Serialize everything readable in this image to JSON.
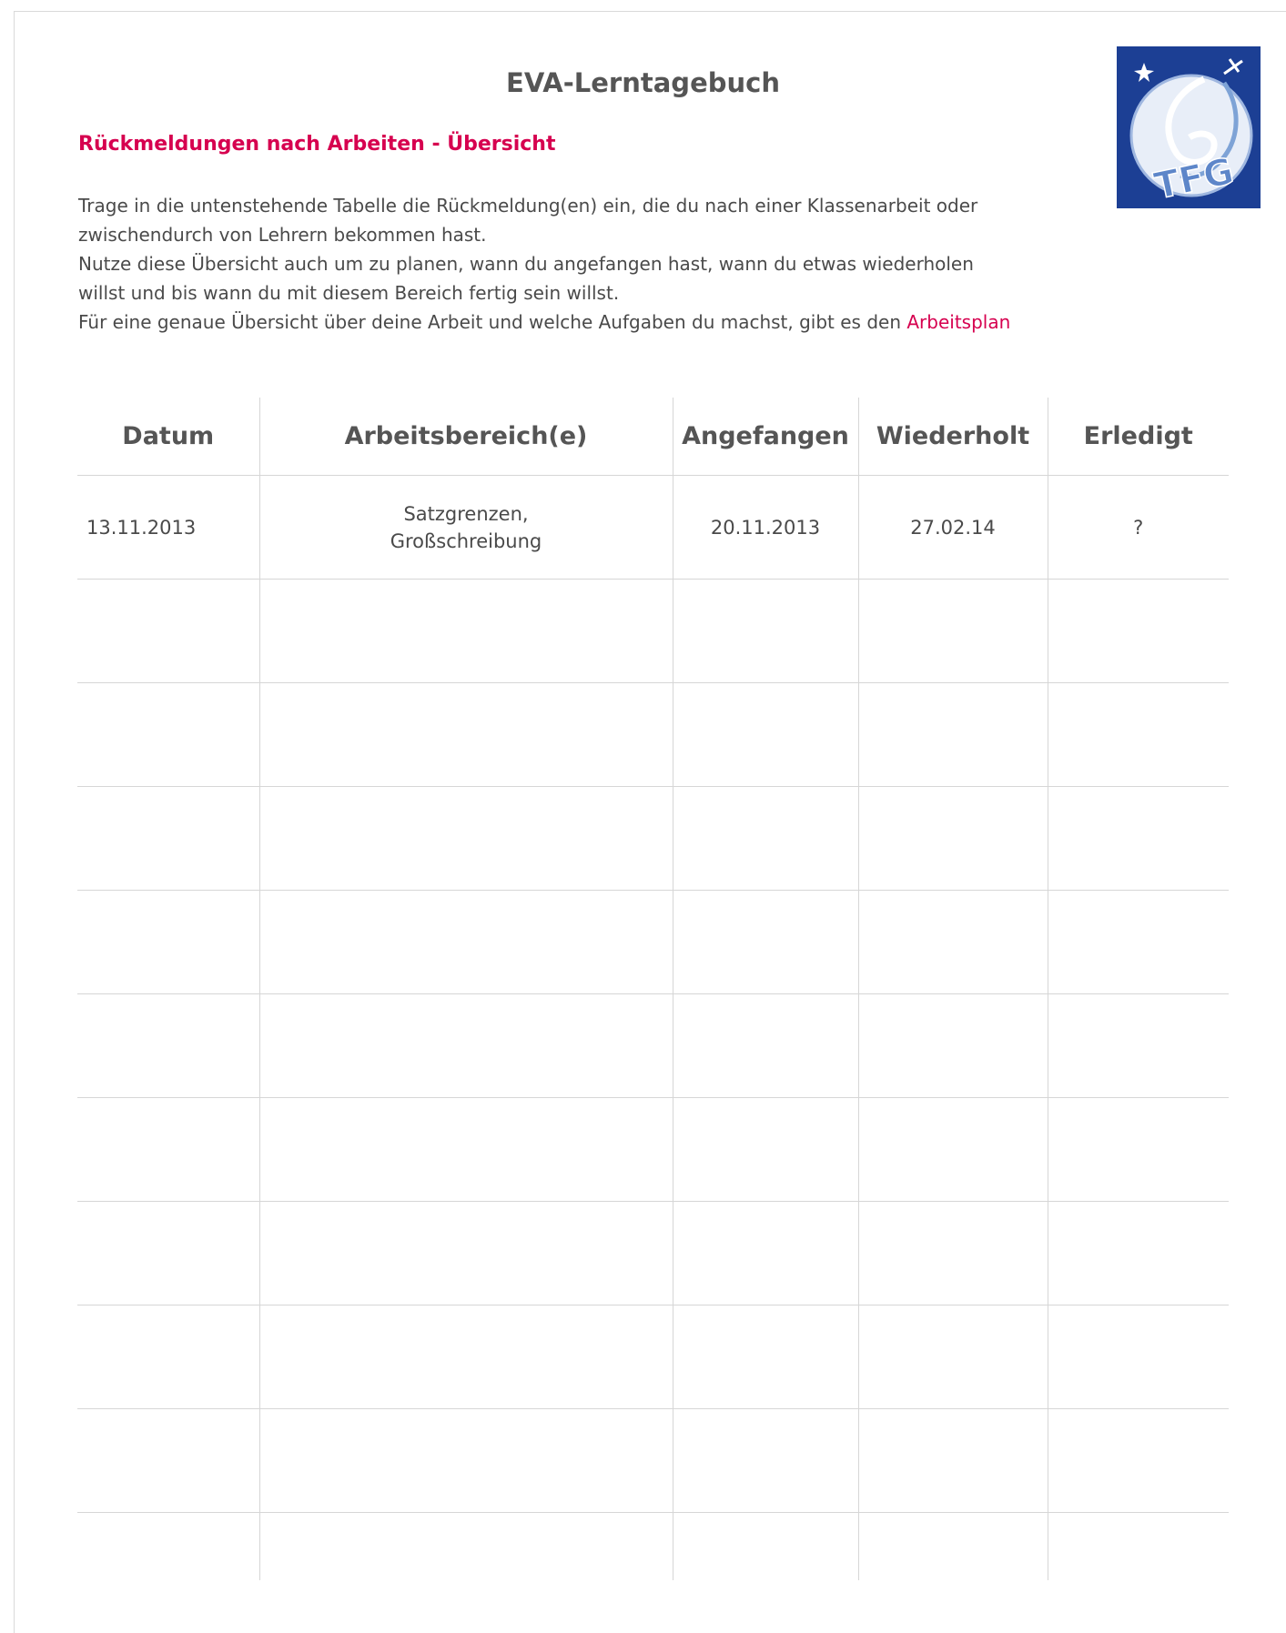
{
  "document": {
    "title": "EVA-Lerntagebuch",
    "subtitle": "Rückmeldungen nach Arbeiten - Übersicht",
    "intro": {
      "line1": "Trage in die untenstehende Tabelle die Rückmeldung(en) ein, die du nach einer Klassenarbeit oder",
      "line2": "zwischendurch von Lehrern bekommen hast.",
      "line3": "Nutze diese Übersicht auch um zu planen, wann du angefangen hast, wann du etwas wiederholen",
      "line4": "willst und bis wann du mit diesem Bereich fertig sein willst.",
      "line5_text": "Für eine genaue Übersicht über deine Arbeit und welche Aufgaben du machst, gibt es den ",
      "line5_link": "Arbeitsplan"
    },
    "logo": {
      "icon": "school-logo",
      "background_color": "#1c3f94",
      "text": "TFG"
    }
  },
  "table": {
    "headers": [
      "Datum",
      "Arbeitsbereich(e)",
      "Angefangen",
      "Wiederholt",
      "Erledigt"
    ],
    "rows": [
      {
        "datum": "13.11.2013",
        "bereich_line1": "Satzgrenzen,",
        "bereich_line2": "Großschreibung",
        "angefangen": "20.11.2013",
        "wiederholt": "27.02.14",
        "erledigt": "?"
      }
    ],
    "empty_rows": 10
  },
  "colors": {
    "accent": "#d6004f",
    "text": "#4a4a4a",
    "grid": "#d6d6d6",
    "logo_blue": "#1c3f94"
  }
}
